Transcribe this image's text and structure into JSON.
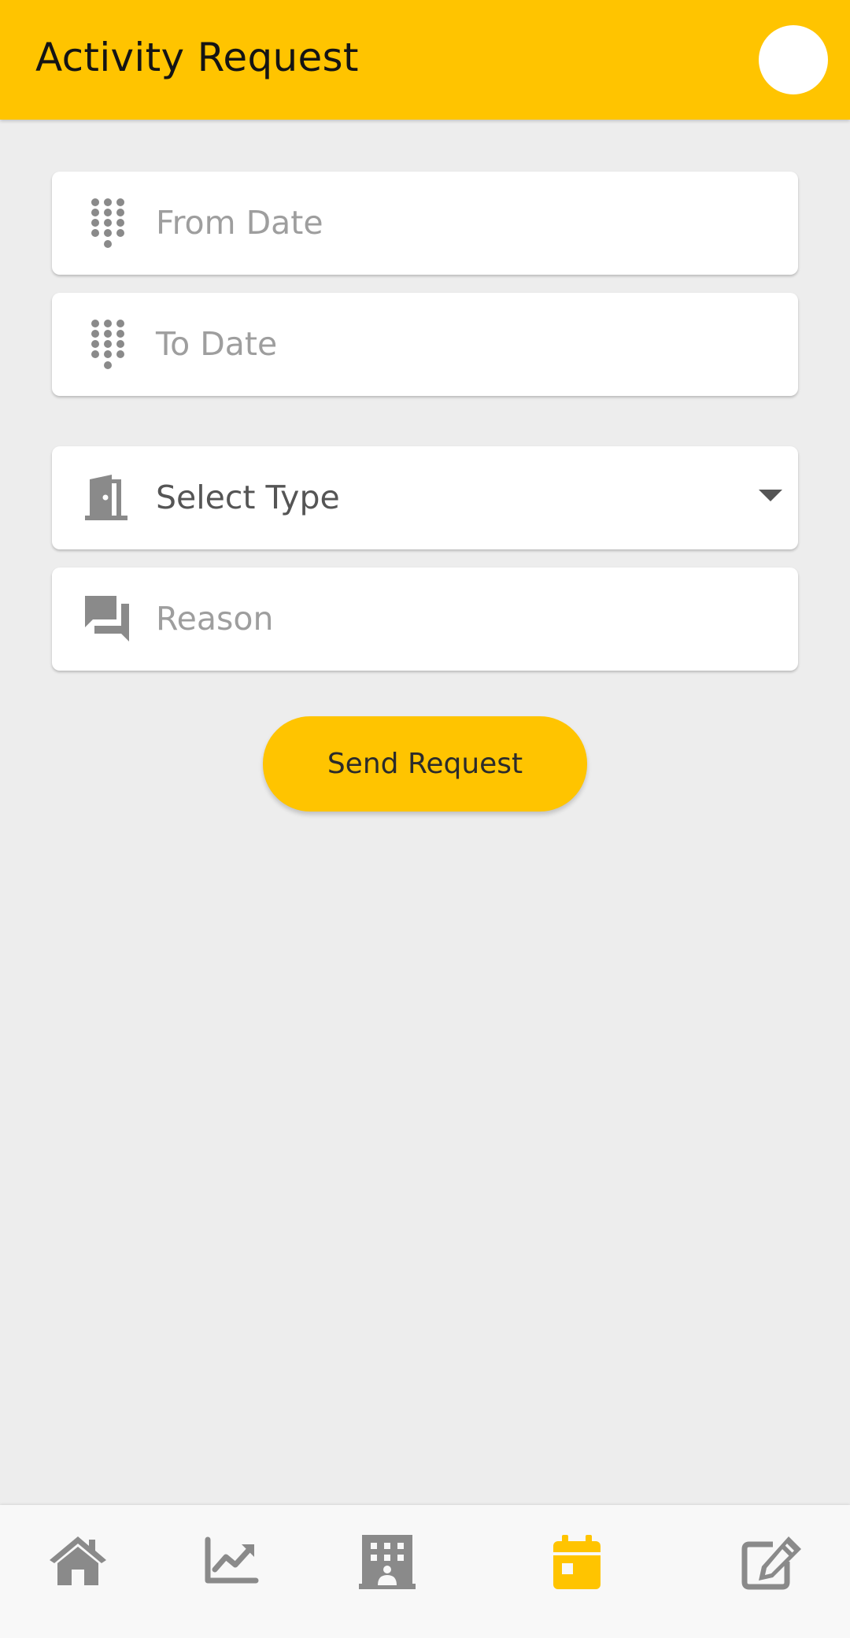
{
  "header": {
    "title": "Activity Request"
  },
  "form": {
    "from_date": {
      "placeholder": "From Date",
      "icon": "dialpad-icon"
    },
    "to_date": {
      "placeholder": "To Date",
      "icon": "dialpad-icon"
    },
    "type": {
      "selected": "Select Type",
      "icon": "door-icon"
    },
    "reason": {
      "placeholder": "Reason",
      "icon": "forum-icon"
    }
  },
  "actions": {
    "send_label": "Send Request"
  },
  "bottom_nav": {
    "items": [
      {
        "icon": "home-icon",
        "active": false
      },
      {
        "icon": "chart-line-icon",
        "active": false
      },
      {
        "icon": "building-icon",
        "active": false
      },
      {
        "icon": "calendar-icon",
        "active": true
      },
      {
        "icon": "edit-icon",
        "active": false
      }
    ]
  },
  "colors": {
    "accent": "#ffc400",
    "icon_inactive": "#8a8a8a",
    "background": "#ededed"
  }
}
